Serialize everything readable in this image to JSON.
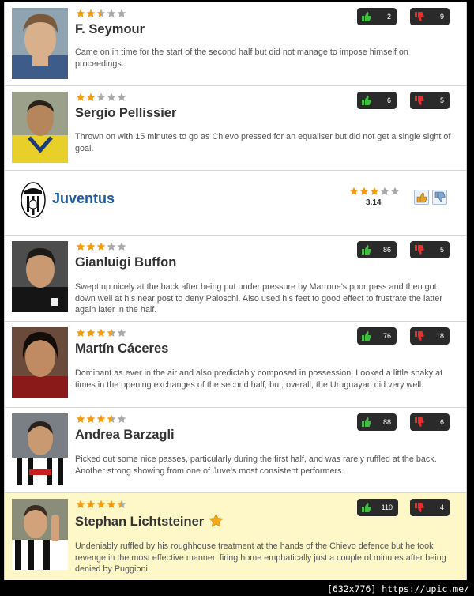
{
  "team": {
    "name": "Juventus",
    "rating": 3,
    "average": "3.14"
  },
  "colors": {
    "star_on": "#f39c12",
    "star_off": "#a9a9a9",
    "team_name": "#1e5b9e",
    "up_icon": "#3fbf3f",
    "down_icon": "#e03030",
    "highlight_row": "#fef8c8"
  },
  "icons": {
    "thumb_up": "thumb-up-icon",
    "thumb_down": "thumb-down-icon",
    "star": "star-icon",
    "man_of_match": "man-of-match-star-icon"
  },
  "players_top": [
    {
      "name": "F. Seymour",
      "rating": 2.5,
      "up": "2",
      "down": "9",
      "comment": "Came on in time for the start of the second half but did not manage to impose himself on proceedings."
    },
    {
      "name": "Sergio Pellissier",
      "rating": 2,
      "up": "6",
      "down": "5",
      "comment": "Thrown on with 15 minutes to go as Chievo pressed for an equaliser but did not get a single sight of goal."
    }
  ],
  "players_bottom": [
    {
      "name": "Gianluigi Buffon",
      "rating": 3,
      "up": "86",
      "down": "5",
      "comment": "Swept up nicely at the back after being put under pressure by Marrone's poor pass and then got down well at his near post to deny Paloschi. Also used his feet to good effect to frustrate the latter again later in the half."
    },
    {
      "name": "Martín Cáceres",
      "rating": 3.5,
      "up": "76",
      "down": "18",
      "comment": "Dominant as ever in the air and also predictably composed in possession. Looked a little shaky at times in the opening exchanges of the second half, but, overall, the Uruguayan did very well."
    },
    {
      "name": "Andrea Barzagli",
      "rating": 3.5,
      "up": "88",
      "down": "6",
      "comment": "Picked out some nice passes, particularly during the first half, and was rarely ruffled at the back. Another strong showing from one of Juve's most consistent performers."
    },
    {
      "name": "Stephan Lichtsteiner",
      "rating": 4.5,
      "up": "110",
      "down": "4",
      "man_of_match": true,
      "comment": "Undeniably ruffled by his roughhouse treatment at the hands of the Chievo defence but he took revenge in the most effective manner, firing home emphatically just a couple of minutes after being denied by Puggioni."
    }
  ],
  "footer": {
    "text": "[632x776] https://upic.me/"
  }
}
